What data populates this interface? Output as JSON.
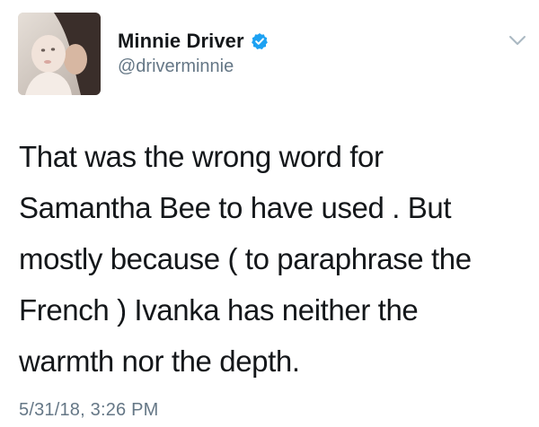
{
  "author": {
    "display_name": "Minnie Driver",
    "handle": "@driverminnie",
    "verified": true,
    "avatar_icon": "profile-photo"
  },
  "tweet": {
    "lines": [
      "That was the wrong word for",
      "Samantha Bee to have used . But",
      "mostly because ( to paraphrase the",
      "French ) Ivanka has neither the",
      "warmth nor the depth."
    ],
    "timestamp": "5/31/18, 3:26 PM"
  },
  "icons": {
    "verified": "verified-badge-icon",
    "menu": "chevron-down-icon"
  },
  "colors": {
    "verified_blue": "#1da1f2",
    "secondary_text": "#657786",
    "primary_text": "#14171a"
  }
}
